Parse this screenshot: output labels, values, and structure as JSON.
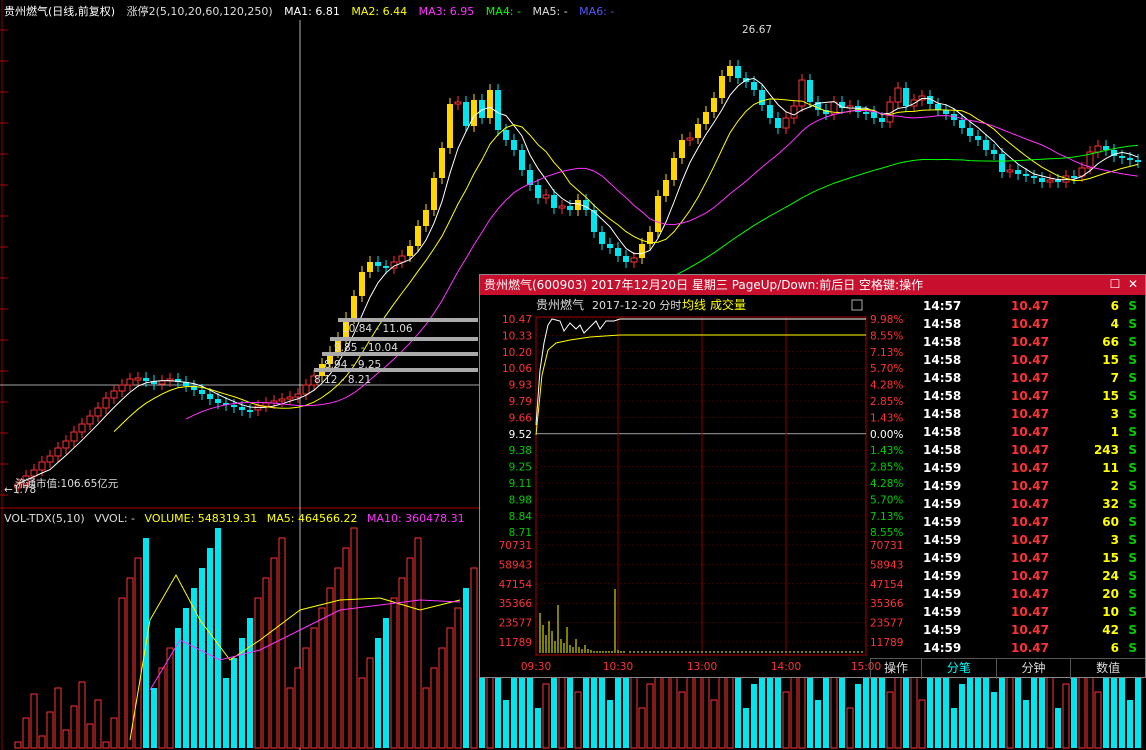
{
  "header": {
    "stock": "贵州燃气(日线,前复权)",
    "indicator": "涨停2(5,10,20,60,120,250)",
    "ma1": "MA1: 6.81",
    "ma2": "MA2: 6.44",
    "ma3": "MA3: 6.95",
    "ma4": "MA4: -",
    "ma5": "MA5: -",
    "ma6": "MA6: -"
  },
  "annotations": {
    "high": "26.67",
    "low": "1.78",
    "market_cap": "流通市值:106.65亿元",
    "gap1": "10.84 - 11.06",
    "gap2": "9.85 - 10.04",
    "gap3": "8.94 - 9.25",
    "gap4": "8.12 - 8.21"
  },
  "volume_header": {
    "name": "VOL-TDX(5,10)",
    "vvol": "VVOL: -",
    "volume": "VOLUME: 548319.31",
    "ma5": "MA5: 464566.22",
    "ma10": "MA10: 360478.31"
  },
  "popup": {
    "title": "贵州燃气(600903) 2017年12月20日 星期三 PageUp/Down:前后日 空格键:操作",
    "sub_name": "贵州燃气",
    "sub_date": "2017-12-20 分时",
    "sub_avg": "均线",
    "sub_vol": "成交量",
    "tabs": [
      "操作",
      "分笔",
      "分钟",
      "数值"
    ],
    "active_tab": "分笔",
    "price_labels": [
      "10.47",
      "10.33",
      "10.20",
      "10.06",
      "9.93",
      "9.79",
      "9.66",
      "9.52",
      "9.38",
      "9.25",
      "9.11",
      "8.98",
      "8.84",
      "8.71"
    ],
    "pct_labels": [
      "9.98%",
      "8.55%",
      "7.13%",
      "5.70%",
      "4.28%",
      "2.85%",
      "1.43%",
      "0.00%",
      "1.43%",
      "2.85%",
      "4.28%",
      "5.70%",
      "7.13%",
      "8.55%"
    ],
    "vol_labels": [
      "70731",
      "58943",
      "47154",
      "35366",
      "23577",
      "11789"
    ],
    "time_labels": [
      "09:30",
      "10:30",
      "13:00",
      "14:00",
      "15:00"
    ],
    "ticks": [
      {
        "time": "14:57",
        "price": "10.47",
        "vol": "6",
        "side": "S"
      },
      {
        "time": "14:58",
        "price": "10.47",
        "vol": "4",
        "side": "S"
      },
      {
        "time": "14:58",
        "price": "10.47",
        "vol": "66",
        "side": "S"
      },
      {
        "time": "14:58",
        "price": "10.47",
        "vol": "15",
        "side": "S"
      },
      {
        "time": "14:58",
        "price": "10.47",
        "vol": "7",
        "side": "S"
      },
      {
        "time": "14:58",
        "price": "10.47",
        "vol": "15",
        "side": "S"
      },
      {
        "time": "14:58",
        "price": "10.47",
        "vol": "3",
        "side": "S"
      },
      {
        "time": "14:58",
        "price": "10.47",
        "vol": "1",
        "side": "S"
      },
      {
        "time": "14:58",
        "price": "10.47",
        "vol": "243",
        "side": "S"
      },
      {
        "time": "14:59",
        "price": "10.47",
        "vol": "11",
        "side": "S"
      },
      {
        "time": "14:59",
        "price": "10.47",
        "vol": "2",
        "side": "S"
      },
      {
        "time": "14:59",
        "price": "10.47",
        "vol": "32",
        "side": "S"
      },
      {
        "time": "14:59",
        "price": "10.47",
        "vol": "60",
        "side": "S"
      },
      {
        "time": "14:59",
        "price": "10.47",
        "vol": "3",
        "side": "S"
      },
      {
        "time": "14:59",
        "price": "10.47",
        "vol": "15",
        "side": "S"
      },
      {
        "time": "14:59",
        "price": "10.47",
        "vol": "24",
        "side": "S"
      },
      {
        "time": "14:59",
        "price": "10.47",
        "vol": "20",
        "side": "S"
      },
      {
        "time": "14:59",
        "price": "10.47",
        "vol": "10",
        "side": "S"
      },
      {
        "time": "14:59",
        "price": "10.47",
        "vol": "42",
        "side": "S"
      },
      {
        "time": "14:59",
        "price": "10.47",
        "vol": "6",
        "side": "S"
      }
    ]
  },
  "colors": {
    "up": "#ff3333",
    "down": "#00e5ee",
    "limit_up": "#ffd700",
    "ma1": "#ffffff",
    "ma2": "#ffff00",
    "ma3": "#ff33ff",
    "ma4": "#00ff00",
    "ma6": "#3333ff",
    "title_bar": "#c8102e"
  },
  "icons": {
    "close": "close-icon",
    "maximize": "maximize-icon"
  }
}
